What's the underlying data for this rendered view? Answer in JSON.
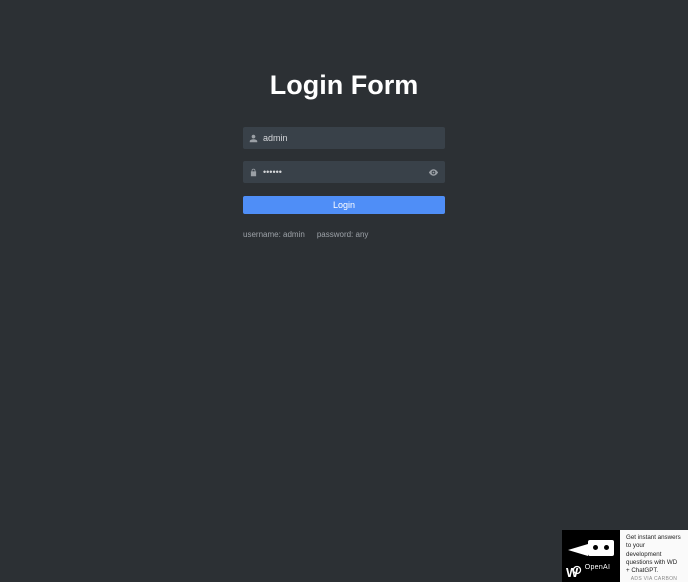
{
  "title": "Login Form",
  "form": {
    "username_value": "admin",
    "password_value": "••••••",
    "submit_label": "Login"
  },
  "hints": {
    "username": "username: admin",
    "password": "password: any"
  },
  "ad": {
    "brand": "OpenAI",
    "copy": "Get instant answers to your development questions with WD + ChatGPT.",
    "credit": "ADS VIA CARBON"
  },
  "icons": {
    "user": "user-icon",
    "lock": "lock-icon",
    "eye": "eye-icon"
  }
}
